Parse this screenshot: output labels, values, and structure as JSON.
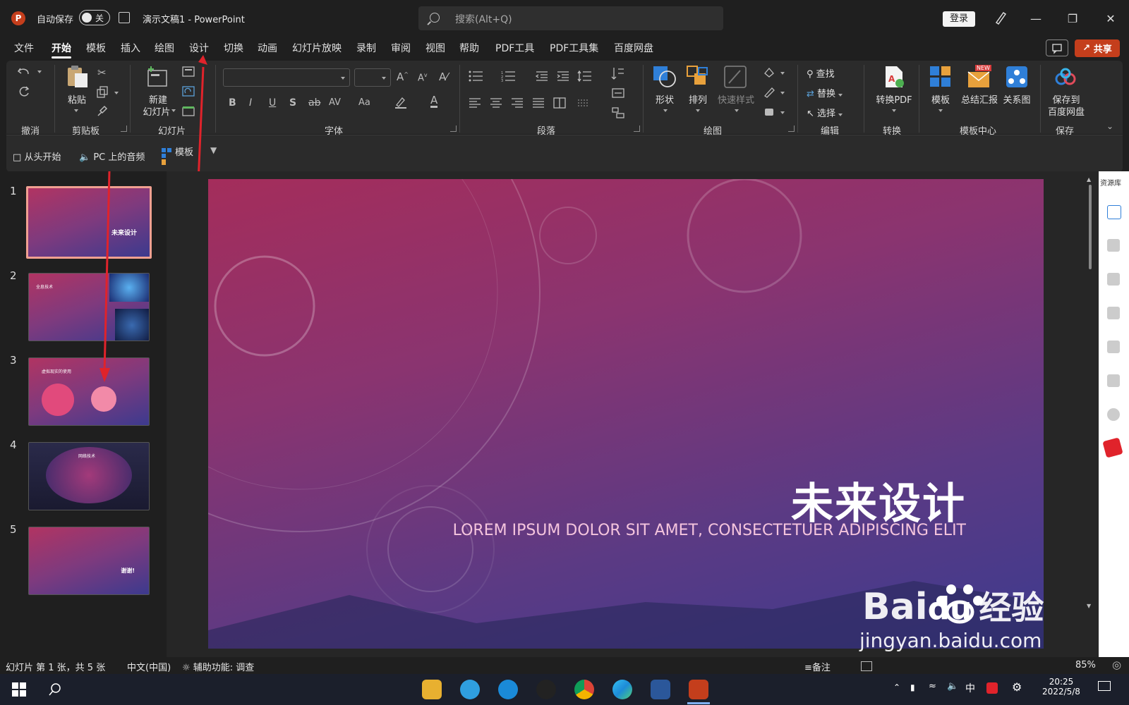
{
  "titlebar": {
    "app_icon": "powerpoint-logo",
    "autosave_label": "自动保存",
    "autosave_state": "关",
    "doc_title": "演示文稿1  -  PowerPoint",
    "search_placeholder": "搜索(Alt+Q)",
    "login_label": "登录"
  },
  "menu": {
    "tabs": [
      "文件",
      "开始",
      "模板",
      "插入",
      "绘图",
      "设计",
      "切换",
      "动画",
      "幻灯片放映",
      "录制",
      "审阅",
      "视图",
      "帮助",
      "PDF工具",
      "PDF工具集",
      "百度网盘"
    ],
    "active_tab": "开始",
    "share_label": "共享"
  },
  "ribbon": {
    "groups": {
      "undo": "撤消",
      "clipboard": "剪贴板",
      "slides": "幻灯片",
      "font": "字体",
      "paragraph": "段落",
      "drawing": "绘图",
      "editing": "编辑",
      "convert": "转换",
      "template_center": "模板中心",
      "save": "保存"
    },
    "paste_label": "粘贴",
    "new_slide_label_1": "新建",
    "new_slide_label_2": "幻灯片",
    "shape_label": "形状",
    "arrange_label": "排列",
    "quick_style_label": "快速样式",
    "find_label": "查找",
    "replace_label": "替换",
    "select_label": "选择",
    "to_pdf_label": "转换PDF",
    "template_label": "模板",
    "summary_label": "总结汇报",
    "relation_label": "关系图",
    "new_badge": "NEW",
    "save_to_label_1": "保存到",
    "save_to_label_2": "百度网盘"
  },
  "qat": {
    "from_start": "从头开始",
    "pc_audio": "PC 上的音频",
    "template": "模板"
  },
  "thumbnails": [
    {
      "num": "1",
      "title": "未来设计"
    },
    {
      "num": "2",
      "title": "全息技术"
    },
    {
      "num": "3",
      "title": "虚拟现实的使用"
    },
    {
      "num": "4",
      "title": "网络技术"
    },
    {
      "num": "5",
      "title": "谢谢!"
    }
  ],
  "slide": {
    "title": "未来设计",
    "subtitle": "LOREM IPSUM DOLOR SIT AMET, CONSECTETUER ADIPISCING ELIT"
  },
  "sidepane": {
    "title": "资源库"
  },
  "status": {
    "slide_info": "幻灯片 第 1 张，共 5 张",
    "language": "中文(中国)",
    "accessibility": "辅助功能: 调查",
    "notes": "备注",
    "zoom": "85%"
  },
  "taskbar": {
    "time": "20:25",
    "date": "2022/5/8",
    "ime": "中"
  },
  "watermark": {
    "brand": "Bai",
    "du": "du",
    "jingyan": "经验",
    "url": "jingyan.baidu.com"
  }
}
